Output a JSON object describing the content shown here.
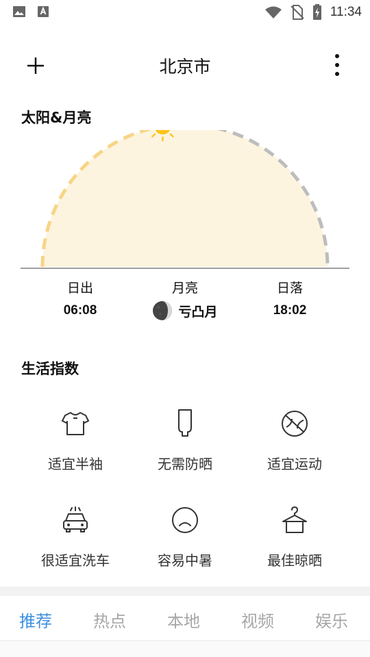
{
  "status_bar": {
    "time": "11:34",
    "icons": [
      "image-icon",
      "text-box-icon",
      "wifi-icon",
      "no-sim-icon",
      "battery-charging-icon"
    ]
  },
  "header": {
    "city": "北京市",
    "add_icon": "plus-icon",
    "menu_icon": "more-vertical-icon"
  },
  "sun_moon": {
    "title": "太阳&月亮",
    "sunrise_label": "日出",
    "sunrise_time": "06:08",
    "moon_label": "月亮",
    "moon_phase": "亏凸月",
    "sunset_label": "日落",
    "sunset_time": "18:02",
    "day_progress": 0.45,
    "colors": {
      "progress": "#f7d585",
      "remaining": "#bdbdbd",
      "fill": "#fdf4e0",
      "sun": "#fcc419"
    }
  },
  "life": {
    "title": "生活指数",
    "items": [
      {
        "label": "适宜半袖",
        "icon": "tshirt-icon"
      },
      {
        "label": "无需防晒",
        "icon": "sunscreen-icon"
      },
      {
        "label": "适宜运动",
        "icon": "ball-icon"
      },
      {
        "label": "很适宜洗车",
        "icon": "car-wash-icon"
      },
      {
        "label": "容易中暑",
        "icon": "sad-face-icon"
      },
      {
        "label": "最佳晾晒",
        "icon": "hanger-icon"
      }
    ]
  },
  "tabs": [
    {
      "label": "推荐",
      "active": true
    },
    {
      "label": "热点",
      "active": false
    },
    {
      "label": "本地",
      "active": false
    },
    {
      "label": "视频",
      "active": false
    },
    {
      "label": "娱乐",
      "active": false
    }
  ]
}
